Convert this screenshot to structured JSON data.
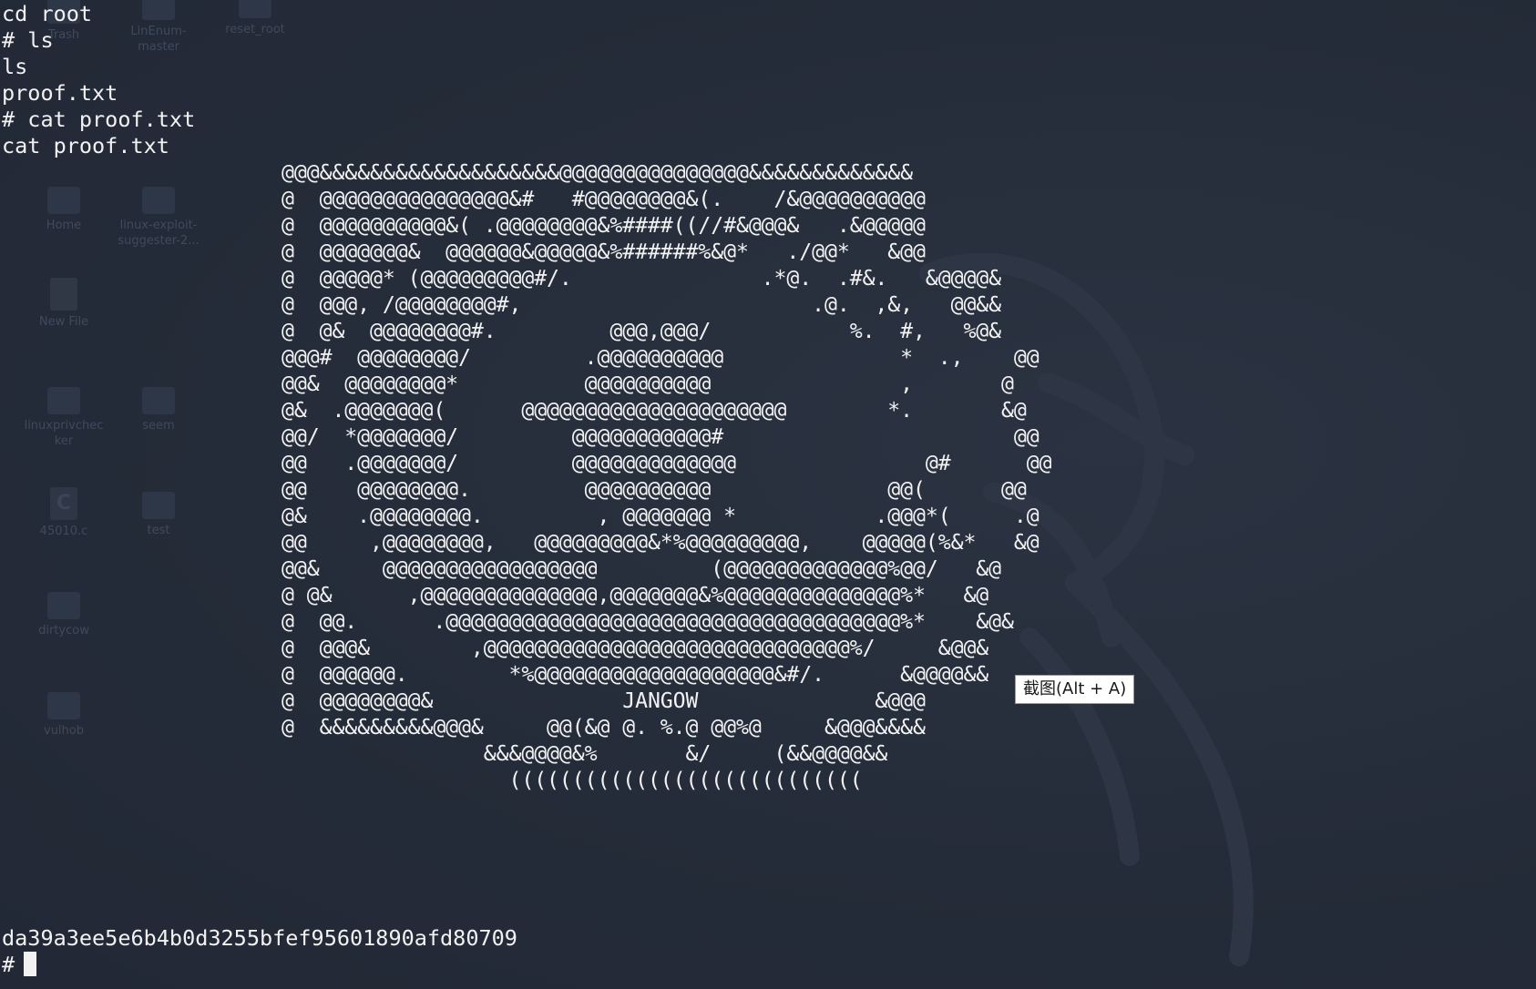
{
  "desktop": {
    "icons": [
      {
        "label": "Trash"
      },
      {
        "label": "LinEnum-\nmaster"
      },
      {
        "label": "reset_root"
      },
      {
        "label": "Home"
      },
      {
        "label": "linux-exploit-\nsuggester-2..."
      },
      {
        "label": "New File"
      },
      {
        "label": "linuxprivchec\nker"
      },
      {
        "label": "seem"
      },
      {
        "label": "45010.c"
      },
      {
        "label": "test"
      },
      {
        "label": "dirtycow"
      },
      {
        "label": "vulhob"
      }
    ]
  },
  "terminal": {
    "lines": [
      "cd root",
      "# ls",
      "ls",
      "proof.txt",
      "# cat proof.txt",
      "cat proof.txt"
    ],
    "banner": "@@@&&&&&&&&&&&&&&&&&&&@@@@@@@@@@@@@@@&&&&&&&&&&&&&\n@  @@@@@@@@@@@@@@@&#   #@@@@@@@@&(.    /&@@@@@@@@@@\n@  @@@@@@@@@@&( .@@@@@@@@&%####((//#&@@@&   .&@@@@@\n@  @@@@@@@&  @@@@@@&@@@@@&%######%&@*   ./@@*   &@@\n@  @@@@@* (@@@@@@@@@#/.               .*@.  .#&.   &@@@@&\n@  @@@, /@@@@@@@@#,                       .@.  ,&,   @@&&\n@  @&  @@@@@@@@#.         @@@,@@@/           %.  #,   %@&\n@@@#  @@@@@@@@/         .@@@@@@@@@@              *  .,    @@\n@@&  @@@@@@@@*          @@@@@@@@@@               ,       @\n@&  .@@@@@@@(      @@@@@@@@@@@@@@@@@@@@@        *.       &@\n@@/  *@@@@@@@/         @@@@@@@@@@@#                       @@\n@@   .@@@@@@@/         @@@@@@@@@@@@@               @#      @@\n@@    @@@@@@@@.         @@@@@@@@@@              @@(      @@\n@&    .@@@@@@@@.         , @@@@@@@ *           .@@@*(     .@\n@@     ,@@@@@@@@,   @@@@@@@@@&*%@@@@@@@@@,    @@@@@(%&*   &@\n@@&     @@@@@@@@@@@@@@@@@         (@@@@@@@@@@@@@%@@/   &@\n@ @&      ,@@@@@@@@@@@@@@,@@@@@@@&%@@@@@@@@@@@@@@%*   &@\n@  @@.      .@@@@@@@@@@@@@@@@@@@@@@@@@@@@@@@@@@@@%*    &@&\n@  @@@&        ,@@@@@@@@@@@@@@@@@@@@@@@@@@@@@%/     &@@&\n@  @@@@@@.        *%@@@@@@@@@@@@@@@@@@@&#/.      &@@@@&&\n@  @@@@@@@@&               JANGOW              &@@@\n@  &&&&&&&&&@@@&     @@(&@ @. %.@ @@%@     &@@@&&&&\n                &&&@@@@&%       &/     (&&@@@@&&\n                  ((((((((((((((((((((((((((((",
    "hash": "da39a3ee5e6b4b0d3255bfef95601890afd80709",
    "prompt": "#"
  },
  "tooltip": {
    "label": "截图(Alt + A)"
  },
  "colors": {
    "background": "#252c39",
    "text": "#f2f2f2",
    "tooltip_bg": "#ffffff"
  }
}
